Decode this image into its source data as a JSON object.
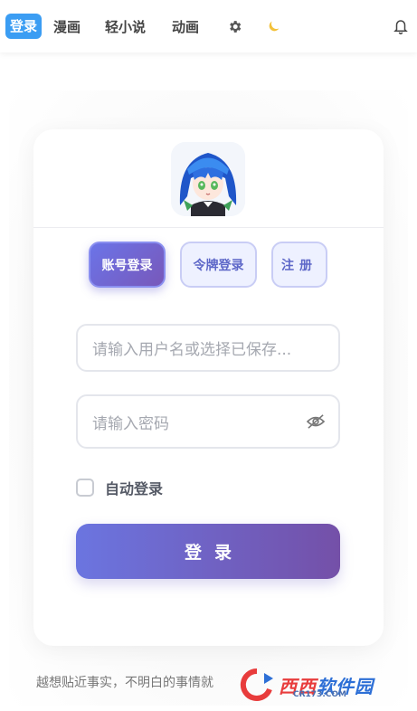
{
  "nav": {
    "login": "登录",
    "items": [
      "漫画",
      "轻小说",
      "动画"
    ],
    "icons": [
      "gear-icon",
      "moon-icon",
      "bell-icon"
    ]
  },
  "card": {
    "tabs": {
      "account_login": "账号登录",
      "token_login": "令牌登录",
      "register": "注册"
    },
    "username_placeholder": "请输入用户名或选择已保存...",
    "password_placeholder": "请输入密码",
    "remember_label": "自动登录",
    "login_button": "登录"
  },
  "footer": {
    "quote": "越想贴近事实，不明白的事情就"
  },
  "watermark": {
    "main_a": "西西",
    "main_b": "软件园",
    "sub": "CR173.COM"
  },
  "colors": {
    "accent_blue": "#3b9df3",
    "gradient_start": "#6b75e0",
    "gradient_end": "#7450a8"
  }
}
